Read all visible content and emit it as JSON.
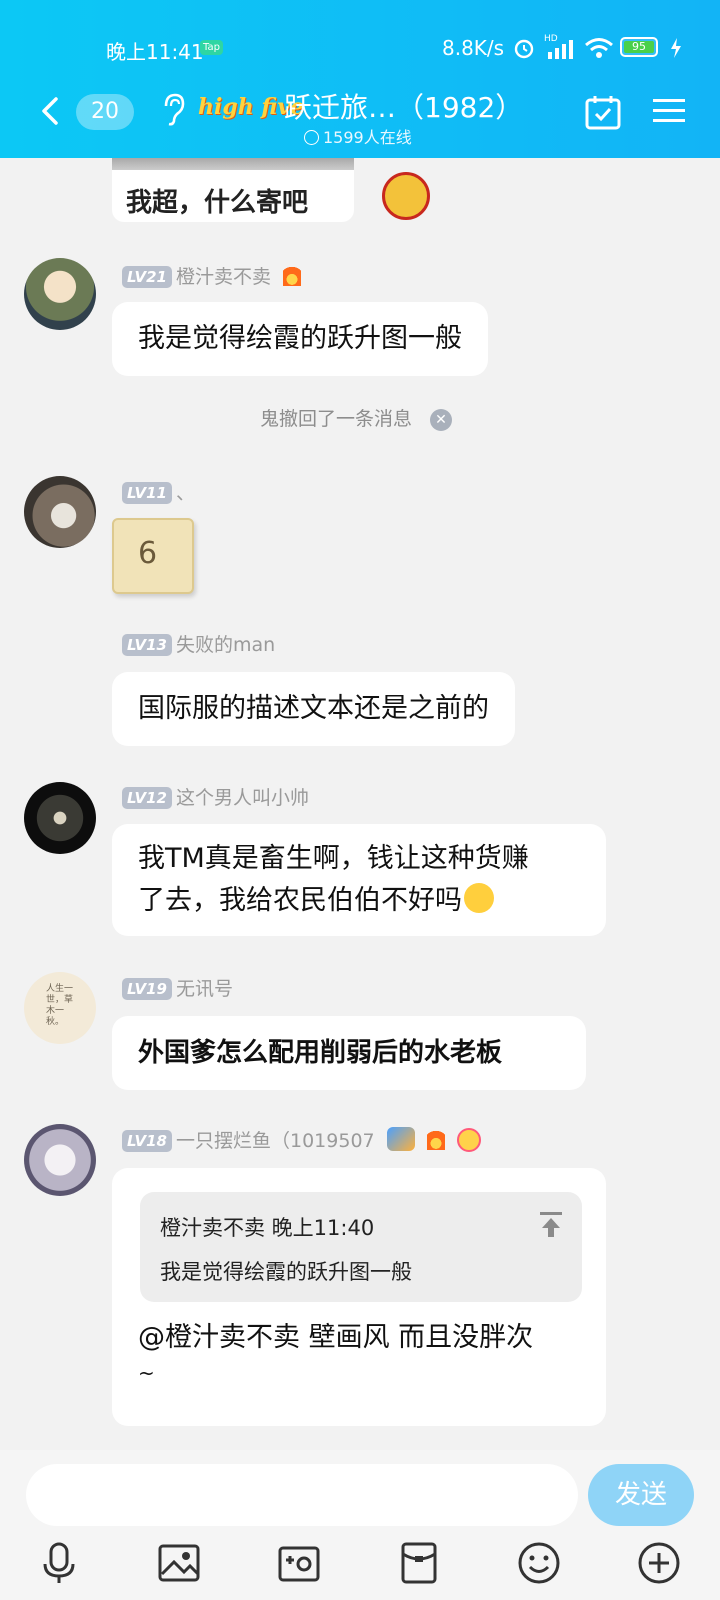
{
  "status_bar": {
    "time": "晚上11:41",
    "tap_label": "Tap",
    "net_speed": "8.8K/s",
    "hd": "HD",
    "battery": "95"
  },
  "header": {
    "unread_count": "20",
    "brand": "high five",
    "title": "跃迁旅…（1982）",
    "online": "1599人在线"
  },
  "top_partial": {
    "image_caption": "我超，什么寄吧"
  },
  "messages": [
    {
      "level": "LV21",
      "name": "橙汁卖不卖",
      "text": "我是觉得绘霞的跃升图一般"
    },
    {
      "level": "LV11",
      "name": "、",
      "sticker_text": "6"
    },
    {
      "level": "LV13",
      "name": "失败的man",
      "text": "国际服的描述文本还是之前的"
    },
    {
      "level": "LV12",
      "name": "这个男人叫小帅",
      "text_line1": "我TM真是畜生啊，钱让这种货赚",
      "text_line2": "了去，我给农民伯伯不好吗"
    },
    {
      "level": "LV19",
      "name": "无讯号",
      "avatar_text": "人生一世，草木一秋。",
      "text": "外国爹怎么配用削弱后的水老板"
    },
    {
      "level": "LV18",
      "name": "一只摆烂鱼（1019507",
      "quote_header": "橙汁卖不卖 晚上11:40",
      "quote_text": "我是觉得绘霞的跃升图一般",
      "text_line1": "@橙汁卖不卖 壁画风 而且没胖次",
      "text_line2": "~"
    }
  ],
  "system_notice": "鬼撤回了一条消息",
  "composer": {
    "send_label": "发送"
  },
  "icons": [
    "mic-icon",
    "image-icon",
    "camera-icon",
    "red-packet-icon",
    "emoji-icon",
    "plus-icon"
  ]
}
